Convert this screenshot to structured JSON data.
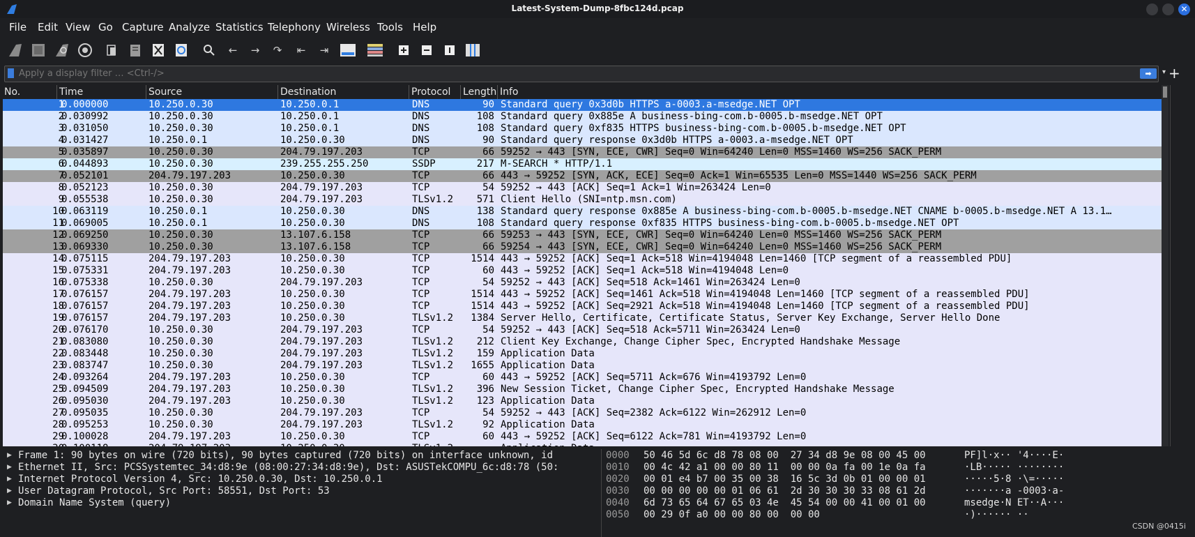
{
  "window": {
    "title": "Latest-System-Dump-8fbc124d.pcap",
    "close_glyph": "✕"
  },
  "menu": [
    "File",
    "Edit",
    "View",
    "Go",
    "Capture",
    "Analyze",
    "Statistics",
    "Telephony",
    "Wireless",
    "Tools",
    "Help"
  ],
  "toolbar_icons": [
    "shark-fin-start-icon",
    "stop-square-icon",
    "restart-fin-icon",
    "capture-options-gear-icon",
    "open-file-icon",
    "save-file-icon",
    "close-file-icon",
    "reload-file-icon",
    "search-icon",
    "go-back-icon",
    "go-forward-icon",
    "go-to-packet-icon",
    "first-packet-icon",
    "last-packet-icon",
    "autoscroll-icon",
    "colorize-icon",
    "zoom-in-icon",
    "zoom-out-icon",
    "normal-size-icon",
    "resize-columns-icon"
  ],
  "filter": {
    "placeholder": "Apply a display filter … <Ctrl-/>",
    "add_glyph": "+"
  },
  "columns": [
    "No.",
    "Time",
    "Source",
    "Destination",
    "Protocol",
    "Length",
    "Info"
  ],
  "colors": {
    "selected": "#2e78e0",
    "tcp_syn": "#a0a0a0",
    "dns": "#dae7fe",
    "udp": "#d8f0ff",
    "tcp": "#e6e6fa"
  },
  "packets": [
    {
      "no": "1",
      "time": "0.000000",
      "src": "10.250.0.30",
      "dst": "10.250.0.1",
      "proto": "DNS",
      "len": "90",
      "info": "Standard query 0x3d0b HTTPS a-0003.a-msedge.NET OPT",
      "color": "selected"
    },
    {
      "no": "2",
      "time": "0.030992",
      "src": "10.250.0.30",
      "dst": "10.250.0.1",
      "proto": "DNS",
      "len": "108",
      "info": "Standard query 0x885e A business-bing-com.b-0005.b-msedge.NET OPT",
      "color": "dns"
    },
    {
      "no": "3",
      "time": "0.031050",
      "src": "10.250.0.30",
      "dst": "10.250.0.1",
      "proto": "DNS",
      "len": "108",
      "info": "Standard query 0xf835 HTTPS business-bing-com.b-0005.b-msedge.NET OPT",
      "color": "dns"
    },
    {
      "no": "4",
      "time": "0.031427",
      "src": "10.250.0.1",
      "dst": "10.250.0.30",
      "proto": "DNS",
      "len": "90",
      "info": "Standard query response 0x3d0b HTTPS a-0003.a-msedge.NET OPT",
      "color": "dns"
    },
    {
      "no": "5",
      "time": "0.035897",
      "src": "10.250.0.30",
      "dst": "204.79.197.203",
      "proto": "TCP",
      "len": "66",
      "info": "59252 → 443 [SYN, ECE, CWR] Seq=0 Win=64240 Len=0 MSS=1460 WS=256 SACK_PERM",
      "color": "tcp_syn"
    },
    {
      "no": "6",
      "time": "0.044893",
      "src": "10.250.0.30",
      "dst": "239.255.255.250",
      "proto": "SSDP",
      "len": "217",
      "info": "M-SEARCH * HTTP/1.1",
      "color": "udp"
    },
    {
      "no": "7",
      "time": "0.052101",
      "src": "204.79.197.203",
      "dst": "10.250.0.30",
      "proto": "TCP",
      "len": "66",
      "info": "443 → 59252 [SYN, ACK, ECE] Seq=0 Ack=1 Win=65535 Len=0 MSS=1440 WS=256 SACK_PERM",
      "color": "tcp_syn"
    },
    {
      "no": "8",
      "time": "0.052123",
      "src": "10.250.0.30",
      "dst": "204.79.197.203",
      "proto": "TCP",
      "len": "54",
      "info": "59252 → 443 [ACK] Seq=1 Ack=1 Win=263424 Len=0",
      "color": "tcp"
    },
    {
      "no": "9",
      "time": "0.055538",
      "src": "10.250.0.30",
      "dst": "204.79.197.203",
      "proto": "TLSv1.2",
      "len": "571",
      "info": "Client Hello (SNI=ntp.msn.com)",
      "color": "tcp"
    },
    {
      "no": "10",
      "time": "0.063119",
      "src": "10.250.0.1",
      "dst": "10.250.0.30",
      "proto": "DNS",
      "len": "138",
      "info": "Standard query response 0x885e A business-bing-com.b-0005.b-msedge.NET CNAME b-0005.b-msedge.NET A 13.1…",
      "color": "dns"
    },
    {
      "no": "11",
      "time": "0.069005",
      "src": "10.250.0.1",
      "dst": "10.250.0.30",
      "proto": "DNS",
      "len": "108",
      "info": "Standard query response 0xf835 HTTPS business-bing-com.b-0005.b-msedge.NET OPT",
      "color": "dns"
    },
    {
      "no": "12",
      "time": "0.069250",
      "src": "10.250.0.30",
      "dst": "13.107.6.158",
      "proto": "TCP",
      "len": "66",
      "info": "59253 → 443 [SYN, ECE, CWR] Seq=0 Win=64240 Len=0 MSS=1460 WS=256 SACK_PERM",
      "color": "tcp_syn"
    },
    {
      "no": "13",
      "time": "0.069330",
      "src": "10.250.0.30",
      "dst": "13.107.6.158",
      "proto": "TCP",
      "len": "66",
      "info": "59254 → 443 [SYN, ECE, CWR] Seq=0 Win=64240 Len=0 MSS=1460 WS=256 SACK_PERM",
      "color": "tcp_syn"
    },
    {
      "no": "14",
      "time": "0.075115",
      "src": "204.79.197.203",
      "dst": "10.250.0.30",
      "proto": "TCP",
      "len": "1514",
      "info": "443 → 59252 [ACK] Seq=1 Ack=518 Win=4194048 Len=1460 [TCP segment of a reassembled PDU]",
      "color": "tcp"
    },
    {
      "no": "15",
      "time": "0.075331",
      "src": "204.79.197.203",
      "dst": "10.250.0.30",
      "proto": "TCP",
      "len": "60",
      "info": "443 → 59252 [ACK] Seq=1 Ack=518 Win=4194048 Len=0",
      "color": "tcp"
    },
    {
      "no": "16",
      "time": "0.075338",
      "src": "10.250.0.30",
      "dst": "204.79.197.203",
      "proto": "TCP",
      "len": "54",
      "info": "59252 → 443 [ACK] Seq=518 Ack=1461 Win=263424 Len=0",
      "color": "tcp"
    },
    {
      "no": "17",
      "time": "0.076157",
      "src": "204.79.197.203",
      "dst": "10.250.0.30",
      "proto": "TCP",
      "len": "1514",
      "info": "443 → 59252 [ACK] Seq=1461 Ack=518 Win=4194048 Len=1460 [TCP segment of a reassembled PDU]",
      "color": "tcp"
    },
    {
      "no": "18",
      "time": "0.076157",
      "src": "204.79.197.203",
      "dst": "10.250.0.30",
      "proto": "TCP",
      "len": "1514",
      "info": "443 → 59252 [ACK] Seq=2921 Ack=518 Win=4194048 Len=1460 [TCP segment of a reassembled PDU]",
      "color": "tcp"
    },
    {
      "no": "19",
      "time": "0.076157",
      "src": "204.79.197.203",
      "dst": "10.250.0.30",
      "proto": "TLSv1.2",
      "len": "1384",
      "info": "Server Hello, Certificate, Certificate Status, Server Key Exchange, Server Hello Done",
      "color": "tcp"
    },
    {
      "no": "20",
      "time": "0.076170",
      "src": "10.250.0.30",
      "dst": "204.79.197.203",
      "proto": "TCP",
      "len": "54",
      "info": "59252 → 443 [ACK] Seq=518 Ack=5711 Win=263424 Len=0",
      "color": "tcp"
    },
    {
      "no": "21",
      "time": "0.083080",
      "src": "10.250.0.30",
      "dst": "204.79.197.203",
      "proto": "TLSv1.2",
      "len": "212",
      "info": "Client Key Exchange, Change Cipher Spec, Encrypted Handshake Message",
      "color": "tcp"
    },
    {
      "no": "22",
      "time": "0.083448",
      "src": "10.250.0.30",
      "dst": "204.79.197.203",
      "proto": "TLSv1.2",
      "len": "159",
      "info": "Application Data",
      "color": "tcp"
    },
    {
      "no": "23",
      "time": "0.083747",
      "src": "10.250.0.30",
      "dst": "204.79.197.203",
      "proto": "TLSv1.2",
      "len": "1655",
      "info": "Application Data",
      "color": "tcp"
    },
    {
      "no": "24",
      "time": "0.093264",
      "src": "204.79.197.203",
      "dst": "10.250.0.30",
      "proto": "TCP",
      "len": "60",
      "info": "443 → 59252 [ACK] Seq=5711 Ack=676 Win=4193792 Len=0",
      "color": "tcp"
    },
    {
      "no": "25",
      "time": "0.094509",
      "src": "204.79.197.203",
      "dst": "10.250.0.30",
      "proto": "TLSv1.2",
      "len": "396",
      "info": "New Session Ticket, Change Cipher Spec, Encrypted Handshake Message",
      "color": "tcp"
    },
    {
      "no": "26",
      "time": "0.095030",
      "src": "204.79.197.203",
      "dst": "10.250.0.30",
      "proto": "TLSv1.2",
      "len": "123",
      "info": "Application Data",
      "color": "tcp"
    },
    {
      "no": "27",
      "time": "0.095035",
      "src": "10.250.0.30",
      "dst": "204.79.197.203",
      "proto": "TCP",
      "len": "54",
      "info": "59252 → 443 [ACK] Seq=2382 Ack=6122 Win=262912 Len=0",
      "color": "tcp"
    },
    {
      "no": "28",
      "time": "0.095253",
      "src": "10.250.0.30",
      "dst": "204.79.197.203",
      "proto": "TLSv1.2",
      "len": "92",
      "info": "Application Data",
      "color": "tcp"
    },
    {
      "no": "29",
      "time": "0.100028",
      "src": "204.79.197.203",
      "dst": "10.250.0.30",
      "proto": "TCP",
      "len": "60",
      "info": "443 → 59252 [ACK] Seq=6122 Ack=781 Win=4193792 Len=0",
      "color": "tcp"
    },
    {
      "no": "30",
      "time": "0.100118",
      "src": "204.79.197.203",
      "dst": "10.250.0.30",
      "proto": "TLSv1.2",
      "len": "",
      "info": "Application Data",
      "color": "tcp"
    }
  ],
  "details": [
    "Frame 1: 90 bytes on wire (720 bits), 90 bytes captured (720 bits) on interface unknown, id",
    "Ethernet II, Src: PCSSystemtec_34:d8:9e (08:00:27:34:d8:9e), Dst: ASUSTekCOMPU_6c:d8:78 (50:",
    "Internet Protocol Version 4, Src: 10.250.0.30, Dst: 10.250.0.1",
    "User Datagram Protocol, Src Port: 58551, Dst Port: 53",
    "Domain Name System (query)"
  ],
  "hex": [
    {
      "off": "0000",
      "bytes": "50 46 5d 6c d8 78 08 00  27 34 d8 9e 08 00 45 00",
      "ascii": "PF]l·x·· '4····E·"
    },
    {
      "off": "0010",
      "bytes": "00 4c 42 a1 00 00 80 11  00 00 0a fa 00 1e 0a fa",
      "ascii": "·LB····· ········"
    },
    {
      "off": "0020",
      "bytes": "00 01 e4 b7 00 35 00 38  16 5c 3d 0b 01 00 00 01",
      "ascii": "·····5·8 ·\\=·····"
    },
    {
      "off": "0030",
      "bytes": "00 00 00 00 00 01 06 61  2d 30 30 30 33 08 61 2d",
      "ascii": "·······a -0003·a-"
    },
    {
      "off": "0040",
      "bytes": "6d 73 65 64 67 65 03 4e  45 54 00 00 41 00 01 00",
      "ascii": "msedge·N ET··A···"
    },
    {
      "off": "0050",
      "bytes": "00 29 0f a0 00 00 80 00  00 00",
      "ascii": "·)······ ··"
    }
  ],
  "watermark": "CSDN @0415i"
}
